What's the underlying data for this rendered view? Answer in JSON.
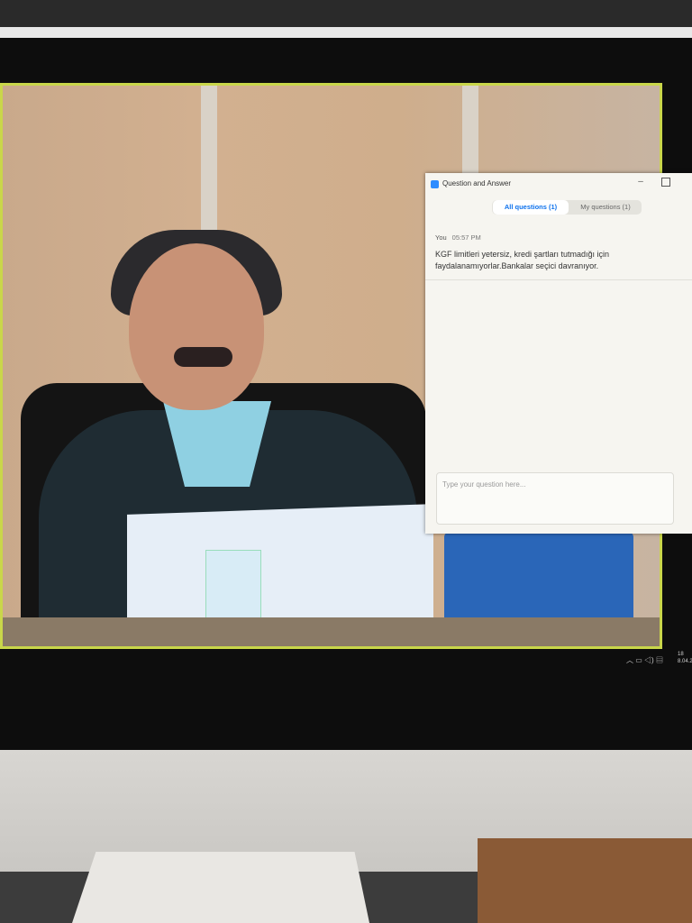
{
  "qa_window": {
    "title": "Question and Answer",
    "tabs": {
      "all": "All questions (1)",
      "my": "My questions (1)"
    },
    "message": {
      "author": "You",
      "time": "05:57 PM",
      "text": "KGF limitleri yetersiz, kredi şartları tutmadığı için faydalanamıyorlar.Bankalar seçici davranıyor."
    },
    "input_placeholder": "Type your question here..."
  },
  "taskbar": {
    "tray_icons": [
      "chevron-up-icon",
      "network-icon",
      "volume-icon",
      "notification-icon"
    ],
    "time": "18",
    "date": "8.04.2"
  },
  "colors": {
    "accent": "#0e72ed",
    "video_border": "#c9d64a",
    "zoom_icon": "#2d8cff"
  }
}
